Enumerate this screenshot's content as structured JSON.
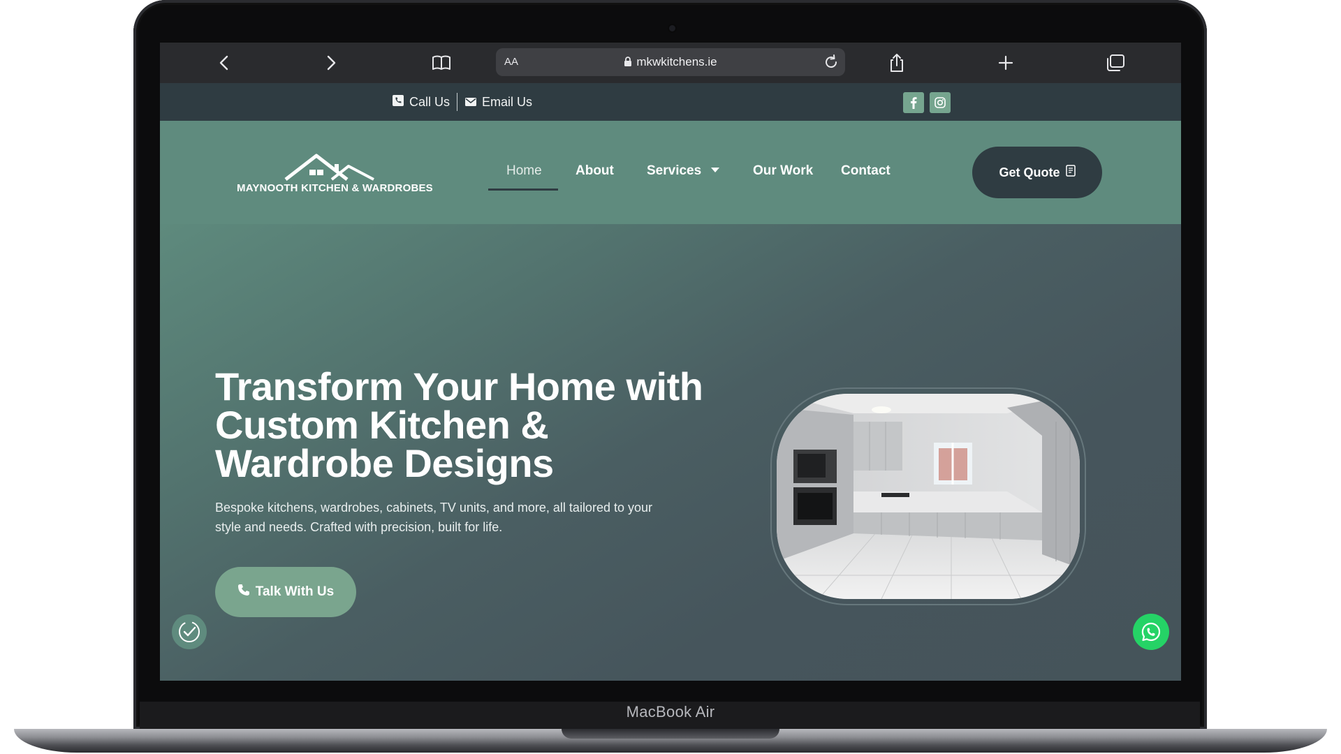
{
  "device": {
    "label": "MacBook Air"
  },
  "browser": {
    "text_size_label": "AA",
    "url": "mkwkitchens.ie",
    "icons": [
      "chevron-left-icon",
      "chevron-right-icon",
      "book-icon",
      "lock-icon",
      "reload-icon",
      "share-icon",
      "plus-icon",
      "tabs-icon"
    ]
  },
  "top_bar": {
    "call_label": "Call Us",
    "email_label": "Email Us",
    "social": [
      "facebook-icon",
      "instagram-icon"
    ]
  },
  "header": {
    "logo_text": "MAYNOOTH KITCHEN & WARDROBES",
    "nav": [
      {
        "label": "Home",
        "active": true
      },
      {
        "label": "About"
      },
      {
        "label": "Services",
        "has_dropdown": true
      },
      {
        "label": "Our Work"
      },
      {
        "label": "Contact"
      }
    ],
    "cta_label": "Get Quote"
  },
  "hero": {
    "title": "Transform Your Home with Custom Kitchen & Wardrobe Designs",
    "subtitle": "Bespoke kitchens, wardrobes, cabinets, TV units, and more, all tailored to your style and needs. Crafted with precision, built for life.",
    "cta_label": "Talk With Us"
  },
  "colors": {
    "header_green": "#5f8b7e",
    "dark_slate": "#2f3c42",
    "button_green": "#7aa58e",
    "whatsapp": "#25d366"
  }
}
